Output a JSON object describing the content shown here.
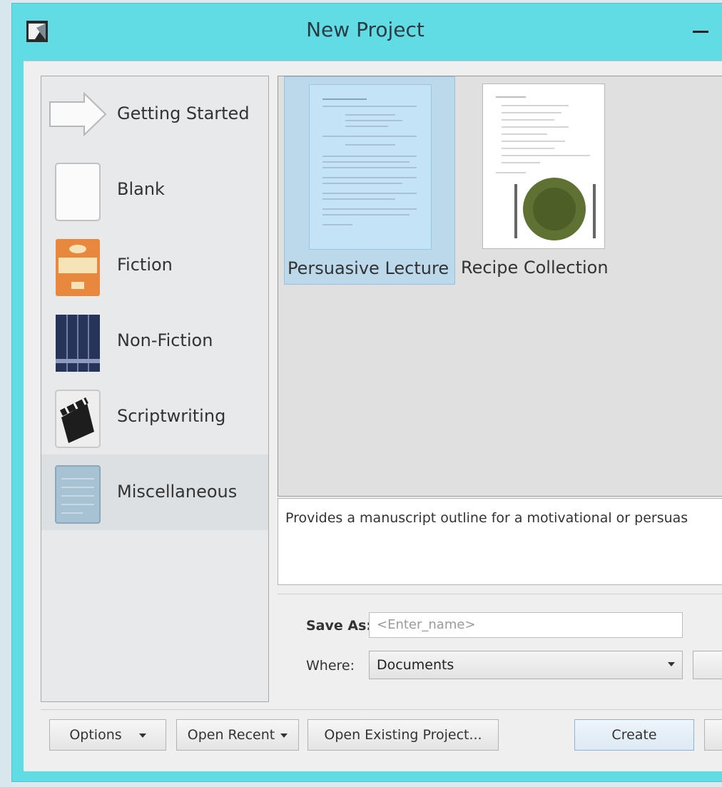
{
  "window": {
    "title": "New Project"
  },
  "categories": [
    {
      "label": "Getting Started",
      "icon": "getting-started-arrow-icon"
    },
    {
      "label": "Blank",
      "icon": "blank-page-icon"
    },
    {
      "label": "Fiction",
      "icon": "fiction-book-icon"
    },
    {
      "label": "Non-Fiction",
      "icon": "non-fiction-binders-icon"
    },
    {
      "label": "Scriptwriting",
      "icon": "clapperboard-icon"
    },
    {
      "label": "Miscellaneous",
      "icon": "miscellaneous-document-icon",
      "selected": true
    }
  ],
  "templates": [
    {
      "label": "Persuasive Lecture",
      "selected": true
    },
    {
      "label": "Recipe Collection",
      "selected": false
    }
  ],
  "description": "Provides a manuscript outline for a motivational or persuas",
  "form": {
    "save_as_label": "Save As:",
    "save_as_placeholder": "<Enter_name>",
    "where_label": "Where:",
    "where_value": "Documents"
  },
  "buttons": {
    "options": "Options",
    "open_recent": "Open Recent",
    "open_existing": "Open Existing Project...",
    "create": "Create"
  },
  "colors": {
    "title_bar": "#62dce4",
    "selection": "#bcd9ec"
  }
}
